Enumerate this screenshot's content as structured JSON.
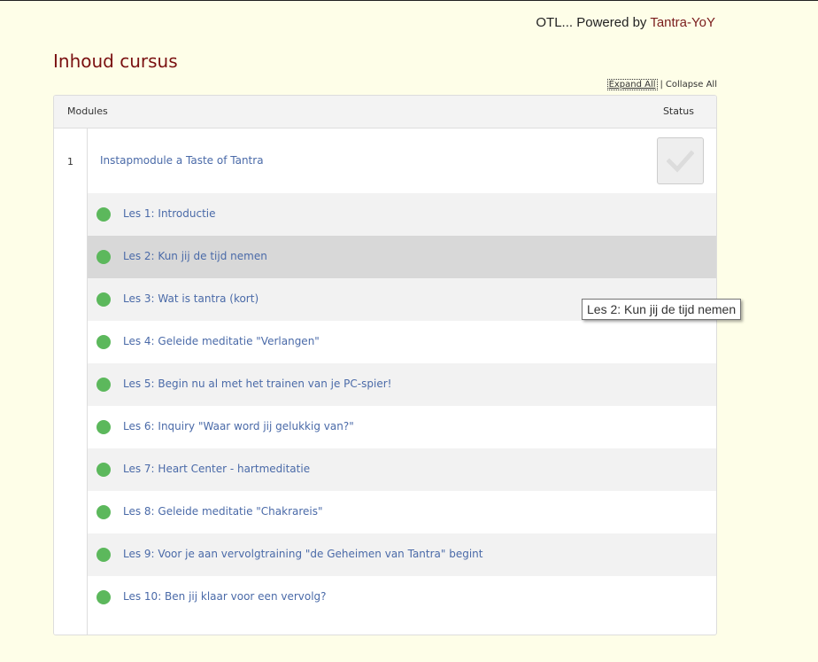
{
  "header": {
    "powered_prefix": "OTL... Powered by ",
    "powered_link": "Tantra-YoY"
  },
  "page_title": "Inhoud cursus",
  "controls": {
    "expand_all": "Expand All",
    "separator": "|",
    "collapse_all": "Collapse All"
  },
  "table": {
    "col_modules": "Modules",
    "col_status": "Status"
  },
  "module": {
    "number": "1",
    "title": "Instapmodule a Taste of Tantra",
    "status_icon": "checkmark-icon"
  },
  "lessons": [
    {
      "label": "Les 1: Introductie"
    },
    {
      "label": "Les 2: Kun jij de tijd nemen"
    },
    {
      "label": "Les 3: Wat is tantra (kort)"
    },
    {
      "label": "Les 4: Geleide meditatie \"Verlangen\""
    },
    {
      "label": "Les 5: Begin nu al met het trainen van je PC-spier!"
    },
    {
      "label": "Les 6: Inquiry \"Waar word jij gelukkig van?\""
    },
    {
      "label": "Les 7: Heart Center - hartmeditatie"
    },
    {
      "label": "Les 8: Geleide meditatie \"Chakrareis\""
    },
    {
      "label": "Les 9: Voor je aan vervolgtraining \"de Geheimen van Tantra\" begint"
    },
    {
      "label": "Les 10: Ben jij klaar voor een vervolg?"
    }
  ],
  "tooltip": "Les 2: Kun jij de tijd nemen",
  "colors": {
    "background": "#fefee8",
    "title": "#7a1010",
    "link": "#4a6aa8",
    "complete_dot": "#5cb85c",
    "hover_row": "#d8d8d8"
  }
}
